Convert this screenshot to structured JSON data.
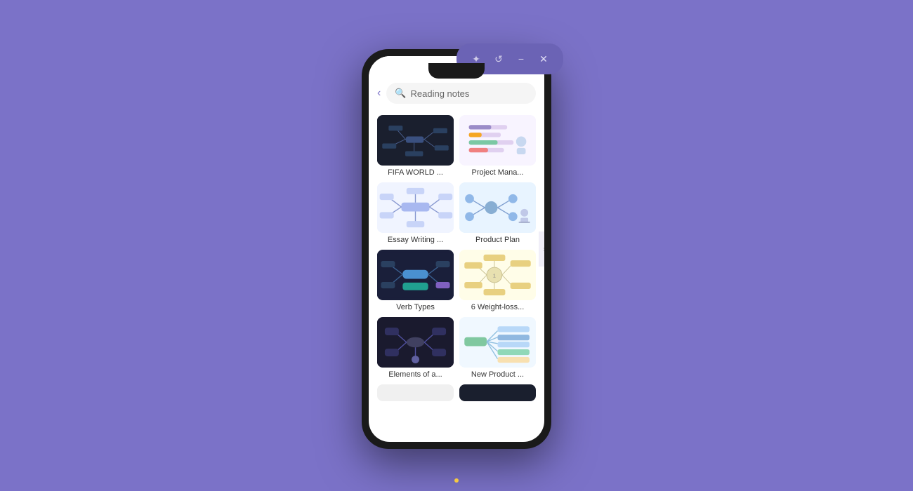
{
  "window": {
    "background_color": "#7b72c8",
    "controls": {
      "star_icon": "✦",
      "history_icon": "↺",
      "minimize_icon": "−",
      "close_icon": "✕"
    }
  },
  "search": {
    "placeholder": "Reading notes",
    "back_icon": "‹"
  },
  "cards": [
    {
      "id": "fifa",
      "label": "FIFA WORLD ...",
      "thumb_type": "fifa"
    },
    {
      "id": "project",
      "label": "Project Mana...",
      "thumb_type": "project"
    },
    {
      "id": "essay",
      "label": "Essay Writing ...",
      "thumb_type": "essay"
    },
    {
      "id": "product-plan",
      "label": "Product Plan",
      "thumb_type": "product-plan"
    },
    {
      "id": "verb",
      "label": "Verb Types",
      "thumb_type": "verb"
    },
    {
      "id": "weight",
      "label": "6 Weight-loss...",
      "thumb_type": "weight"
    },
    {
      "id": "elements",
      "label": "Elements of a...",
      "thumb_type": "elements"
    },
    {
      "id": "new-product",
      "label": "New Product ...",
      "thumb_type": "new-product"
    },
    {
      "id": "partial1",
      "label": "",
      "thumb_type": "partial-1"
    },
    {
      "id": "partial2",
      "label": "",
      "thumb_type": "partial-2"
    }
  ]
}
